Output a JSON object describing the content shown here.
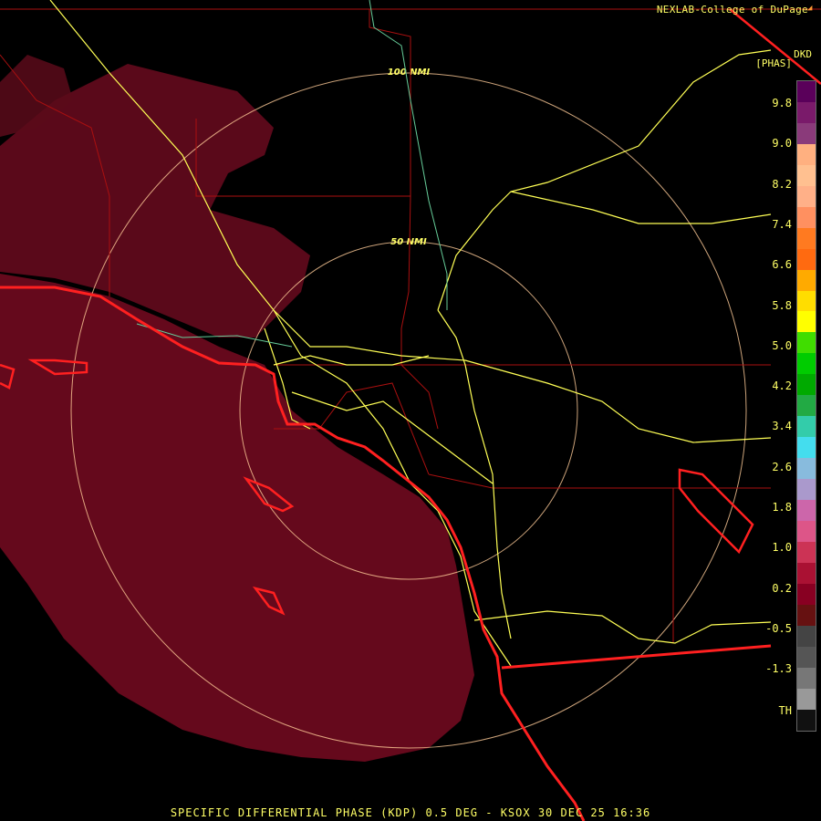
{
  "header": {
    "credit": "NEXLAB-College of DuPage",
    "credit_icon": "logo-icon",
    "product_code": "DKD",
    "product_unit": "[PHAS]"
  },
  "map": {
    "range_rings": [
      {
        "label": "100 NMI"
      },
      {
        "label": "50 NMI"
      }
    ],
    "colors": {
      "background": "#000000",
      "rings": "#ffcc99",
      "roads": "#ffff55",
      "coast": "#ff2020",
      "counties": "#aa1010",
      "echo": "#6a0a1e"
    }
  },
  "colorbar": {
    "labels": [
      "9.8",
      "9.0",
      "8.2",
      "7.4",
      "6.6",
      "5.8",
      "5.0",
      "4.2",
      "3.4",
      "2.6",
      "1.8",
      "1.0",
      "0.2",
      "-0.5",
      "-1.3",
      "TH"
    ],
    "segments": [
      "#5a005a",
      "#7a1a6a",
      "#8a3a7a",
      "#ffb080",
      "#ffc090",
      "#ffb088",
      "#ff9060",
      "#ff7a20",
      "#ff6a10",
      "#ffaa00",
      "#ffdd00",
      "#ffff00",
      "#40dd00",
      "#00cc00",
      "#00aa00",
      "#22aa44",
      "#33ccaa",
      "#44ddee",
      "#88bbdd",
      "#aa99cc",
      "#cc66aa",
      "#dd5588",
      "#cc3355",
      "#aa1133",
      "#880022",
      "#661111",
      "#444444",
      "#555555",
      "#777777",
      "#999999",
      "#111111"
    ]
  },
  "footer": {
    "caption": "SPECIFIC DIFFERENTIAL PHASE (KDP) 0.5 DEG - KSOX 30 DEC 25 16:36"
  }
}
